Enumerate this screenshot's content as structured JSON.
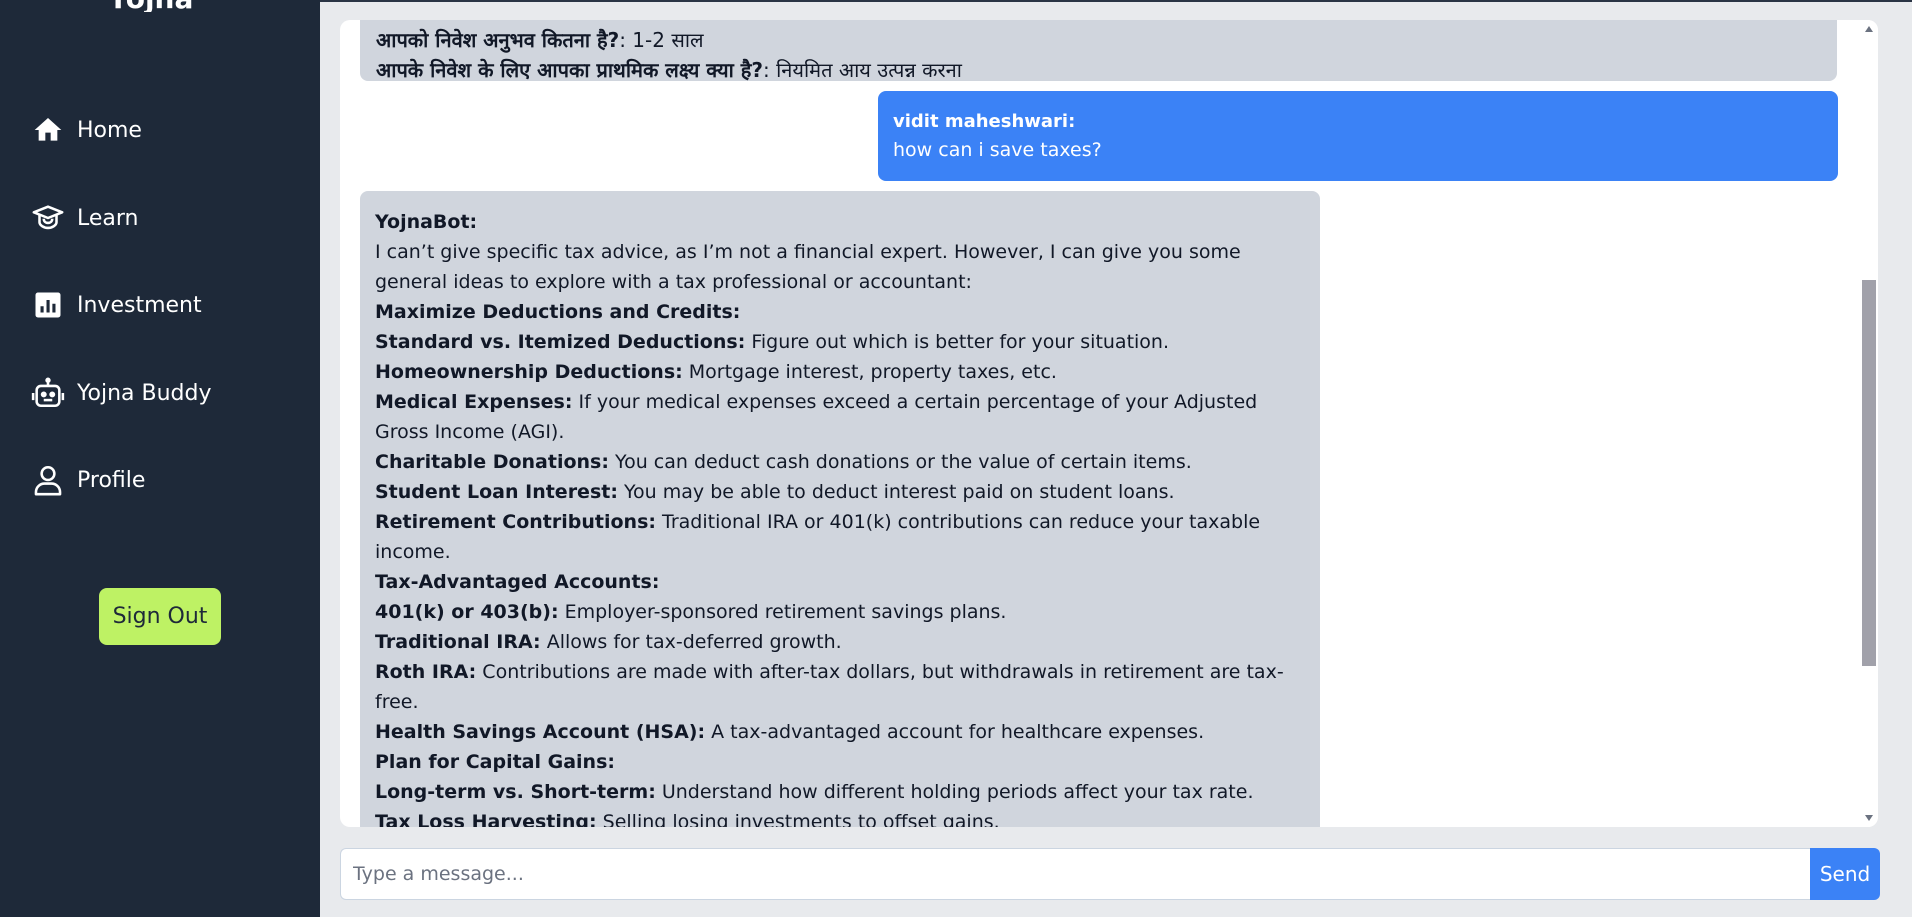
{
  "sidebar": {
    "logo_text": "Yojna",
    "items": [
      {
        "label": "Home",
        "icon": "home-icon"
      },
      {
        "label": "Learn",
        "icon": "graduation-cap-icon"
      },
      {
        "label": "Investment",
        "icon": "chart-icon"
      },
      {
        "label": "Yojna Buddy",
        "icon": "robot-icon"
      },
      {
        "label": "Profile",
        "icon": "user-icon"
      }
    ],
    "signout_label": "Sign Out"
  },
  "chat": {
    "prev_bot": {
      "line1_q": "आपको निवेश अनुभव कितना है?",
      "line1_a": ": 1-2 साल",
      "line2_q": "आपके निवेश के लिए आपका प्राथमिक लक्ष्य क्या है?",
      "line2_a": ": नियमित आय उत्पन्न करना"
    },
    "user_msg": {
      "sender": "vidit maheshwari:",
      "text": "how can i save taxes?"
    },
    "bot_msg": {
      "sender": "YojnaBot:",
      "lines": [
        {
          "b": "",
          "t": "I can’t give specific tax advice, as I’m not a financial expert. However, I can give you some"
        },
        {
          "b": "",
          "t": "general ideas to explore with a tax professional or accountant:"
        },
        {
          "b": "Maximize Deductions and Credits:",
          "t": ""
        },
        {
          "b": "Standard vs. Itemized Deductions:",
          "t": " Figure out which is better for your situation."
        },
        {
          "b": "Homeownership Deductions:",
          "t": " Mortgage interest, property taxes, etc."
        },
        {
          "b": "Medical Expenses:",
          "t": " If your medical expenses exceed a certain percentage of your Adjusted"
        },
        {
          "b": "",
          "t": "Gross Income (AGI)."
        },
        {
          "b": "Charitable Donations:",
          "t": " You can deduct cash donations or the value of certain items."
        },
        {
          "b": "Student Loan Interest:",
          "t": " You may be able to deduct interest paid on student loans."
        },
        {
          "b": "Retirement Contributions:",
          "t": " Traditional IRA or 401(k) contributions can reduce your taxable"
        },
        {
          "b": "",
          "t": "income."
        },
        {
          "b": "Tax-Advantaged Accounts:",
          "t": ""
        },
        {
          "b": "401(k) or 403(b):",
          "t": " Employer-sponsored retirement savings plans."
        },
        {
          "b": "Traditional IRA:",
          "t": " Allows for tax-deferred growth."
        },
        {
          "b": "Roth IRA:",
          "t": " Contributions are made with after-tax dollars, but withdrawals in retirement are tax-"
        },
        {
          "b": "",
          "t": "free."
        },
        {
          "b": "Health Savings Account (HSA):",
          "t": " A tax-advantaged account for healthcare expenses."
        },
        {
          "b": "Plan for Capital Gains:",
          "t": ""
        },
        {
          "b": "Long-term vs. Short-term:",
          "t": " Understand how different holding periods affect your tax rate."
        },
        {
          "b": "Tax Loss Harvesting:",
          "t": " Selling losing investments to offset gains."
        }
      ]
    }
  },
  "input": {
    "placeholder": "Type a message...",
    "send_label": "Send"
  },
  "colors": {
    "sidebar_bg": "#1e2939",
    "accent_blue": "#3b82f6",
    "signout_green": "#bef264",
    "bot_bubble": "#d0d5dd"
  }
}
